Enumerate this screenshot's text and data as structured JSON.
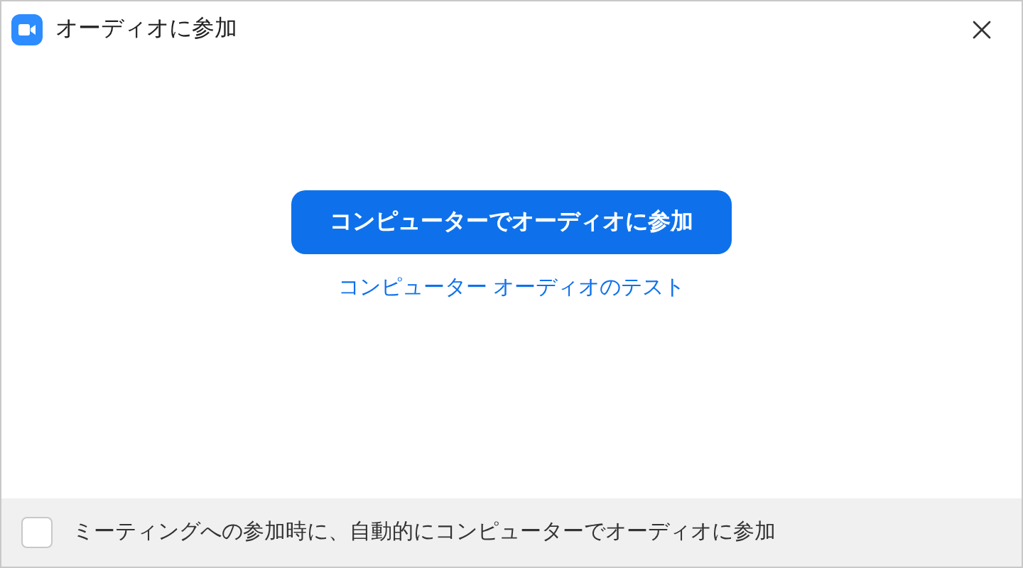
{
  "window": {
    "title": "オーディオに参加"
  },
  "join_button": {
    "label": "コンピューターでオーディオに参加"
  },
  "test_link": {
    "label": "コンピューター オーディオのテスト"
  },
  "auto_join": {
    "label": "ミーティングへの参加時に、自動的にコンピューターでオーディオに参加",
    "checked": false
  }
}
